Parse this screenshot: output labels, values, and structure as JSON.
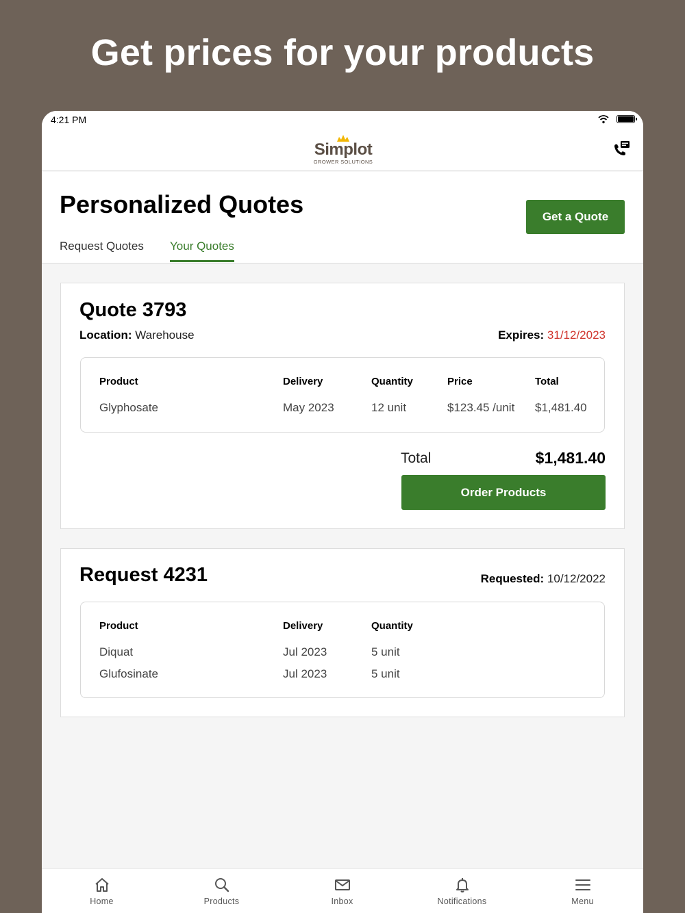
{
  "headline": "Get prices for your products",
  "status_bar": {
    "time": "4:21 PM"
  },
  "brand": {
    "name": "Simplot",
    "tagline": "GROWER SOLUTIONS"
  },
  "page": {
    "title": "Personalized Quotes",
    "get_quote_label": "Get a Quote",
    "tabs": [
      {
        "label": "Request Quotes",
        "active": false
      },
      {
        "label": "Your Quotes",
        "active": true
      }
    ]
  },
  "quote": {
    "title": "Quote 3793",
    "location_label": "Location:",
    "location_value": "Warehouse",
    "expires_label": "Expires:",
    "expires_value": "31/12/2023",
    "columns": [
      "Product",
      "Delivery",
      "Quantity",
      "Price",
      "Total"
    ],
    "rows": [
      {
        "product": "Glyphosate",
        "delivery": "May 2023",
        "quantity": "12 unit",
        "price": "$123.45 /unit",
        "total": "$1,481.40"
      }
    ],
    "total_label": "Total",
    "total_value": "$1,481.40",
    "order_label": "Order Products"
  },
  "request": {
    "title": "Request 4231",
    "requested_label": "Requested:",
    "requested_value": "10/12/2022",
    "columns": [
      "Product",
      "Delivery",
      "Quantity"
    ],
    "rows": [
      {
        "product": "Diquat",
        "delivery": "Jul 2023",
        "quantity": "5 unit"
      },
      {
        "product": "Glufosinate",
        "delivery": "Jul 2023",
        "quantity": "5 unit"
      }
    ]
  },
  "tabbar": [
    {
      "label": "Home",
      "icon": "home-icon"
    },
    {
      "label": "Products",
      "icon": "search-icon"
    },
    {
      "label": "Inbox",
      "icon": "mail-icon"
    },
    {
      "label": "Notifications",
      "icon": "bell-icon"
    },
    {
      "label": "Menu",
      "icon": "menu-icon"
    }
  ],
  "colors": {
    "background": "#6e6258",
    "accent_green": "#3a7d2c",
    "expiry_red": "#d0342c",
    "brand_brown": "#5b4f45",
    "logo_gold": "#f2b705"
  }
}
